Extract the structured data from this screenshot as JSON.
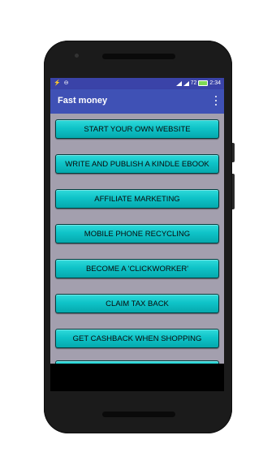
{
  "status_bar": {
    "left_icons": "⚡ ⊖",
    "signal": "72",
    "time": "2:34",
    "battery_color": "#7ed957"
  },
  "app_bar": {
    "title": "Fast money",
    "menu_icon": "overflow-menu-icon",
    "color": "#3f51b5"
  },
  "buttons": [
    "START YOUR OWN WEBSITE",
    "WRITE AND PUBLISH A KINDLE EBOOK",
    "AFFILIATE MARKETING",
    "MOBILE PHONE RECYCLING",
    "BECOME A 'CLICKWORKER'",
    "CLAIM TAX BACK",
    "GET CASHBACK WHEN SHOPPING",
    ""
  ],
  "colors": {
    "background": "#a39fae",
    "button": "#0fc3c8"
  }
}
